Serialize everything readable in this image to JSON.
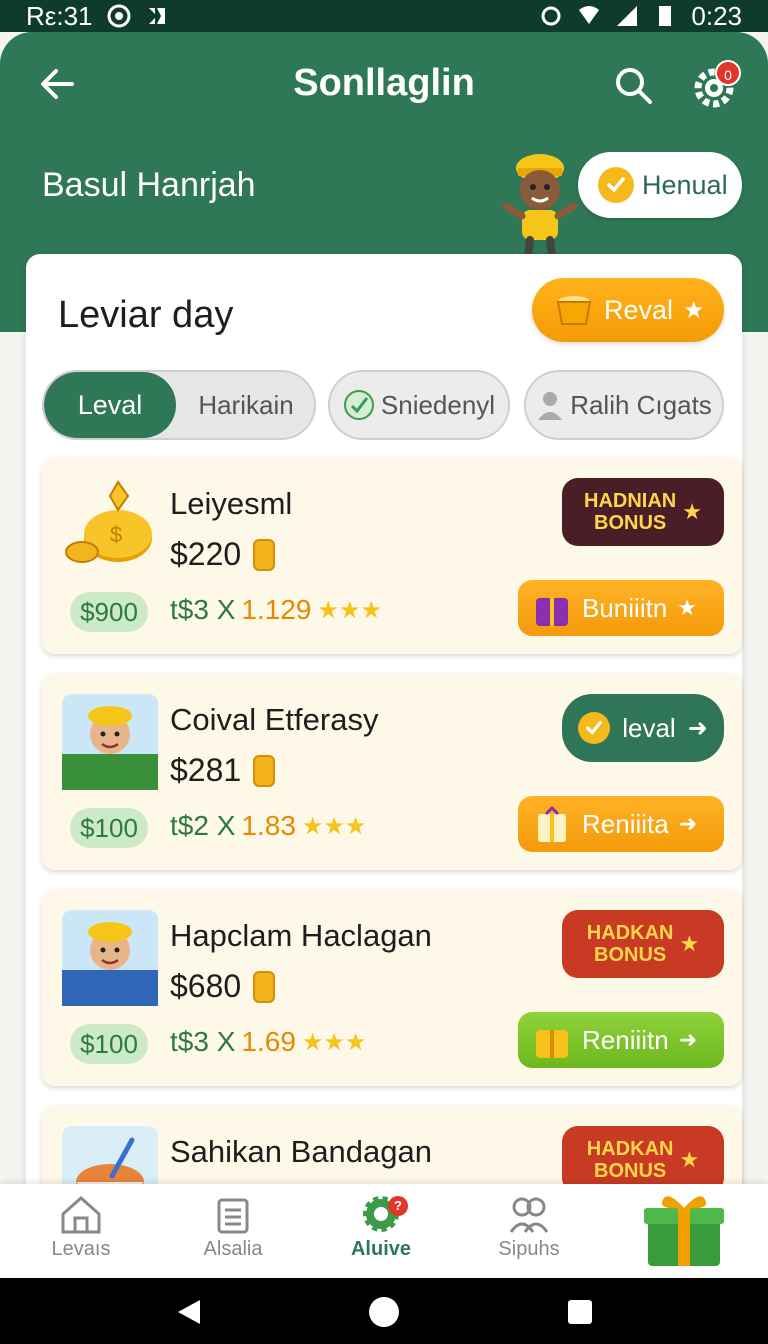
{
  "statusbar": {
    "left_text": "Rε:31",
    "time": "0:23"
  },
  "header": {
    "title": "Sonllaglin",
    "user_name": "Basul Hanrjah",
    "status_label": "Henual",
    "notification_count": "0"
  },
  "panel": {
    "title": "Leviar day",
    "reward_button": "Reval",
    "tabs": {
      "active": "Leval",
      "inactive": "Harikain"
    },
    "chips": [
      "Sniedenyl",
      "Ralih Cıgats"
    ]
  },
  "cards": [
    {
      "name": "Leiyesml",
      "price": "$220",
      "deposit": "$900",
      "multiplier": "t$3 X",
      "rate": "1.129",
      "badge": [
        "HADNIAN",
        "BONUS"
      ],
      "action": "Buniiitn"
    },
    {
      "name": "Coival Etferasy",
      "price": "$281",
      "deposit": "$100",
      "multiplier": "t$2 X",
      "rate": "1.83",
      "badge_label": "leval",
      "action": "Reniiita"
    },
    {
      "name": "Hapclam Haclagan",
      "price": "$680",
      "deposit": "$100",
      "multiplier": "t$3 X",
      "rate": "1.69",
      "badge": [
        "HADKAN",
        "BONUS"
      ],
      "action": "Reniiitn"
    },
    {
      "name": "Sahikan Bandagan",
      "badge": [
        "HADKAN",
        "BONUS"
      ]
    }
  ],
  "bottom_nav": [
    {
      "label": "Levaıs",
      "icon": "home-icon"
    },
    {
      "label": "Alsalia",
      "icon": "clipboard-icon"
    },
    {
      "label": "Aluive",
      "icon": "gear-icon",
      "badge": "?"
    },
    {
      "label": "Sipuhs",
      "icon": "people-icon"
    }
  ],
  "colors": {
    "primary_green": "#2e7757",
    "accent_orange": "#f59a05",
    "card_bg": "#fdf8e7"
  }
}
